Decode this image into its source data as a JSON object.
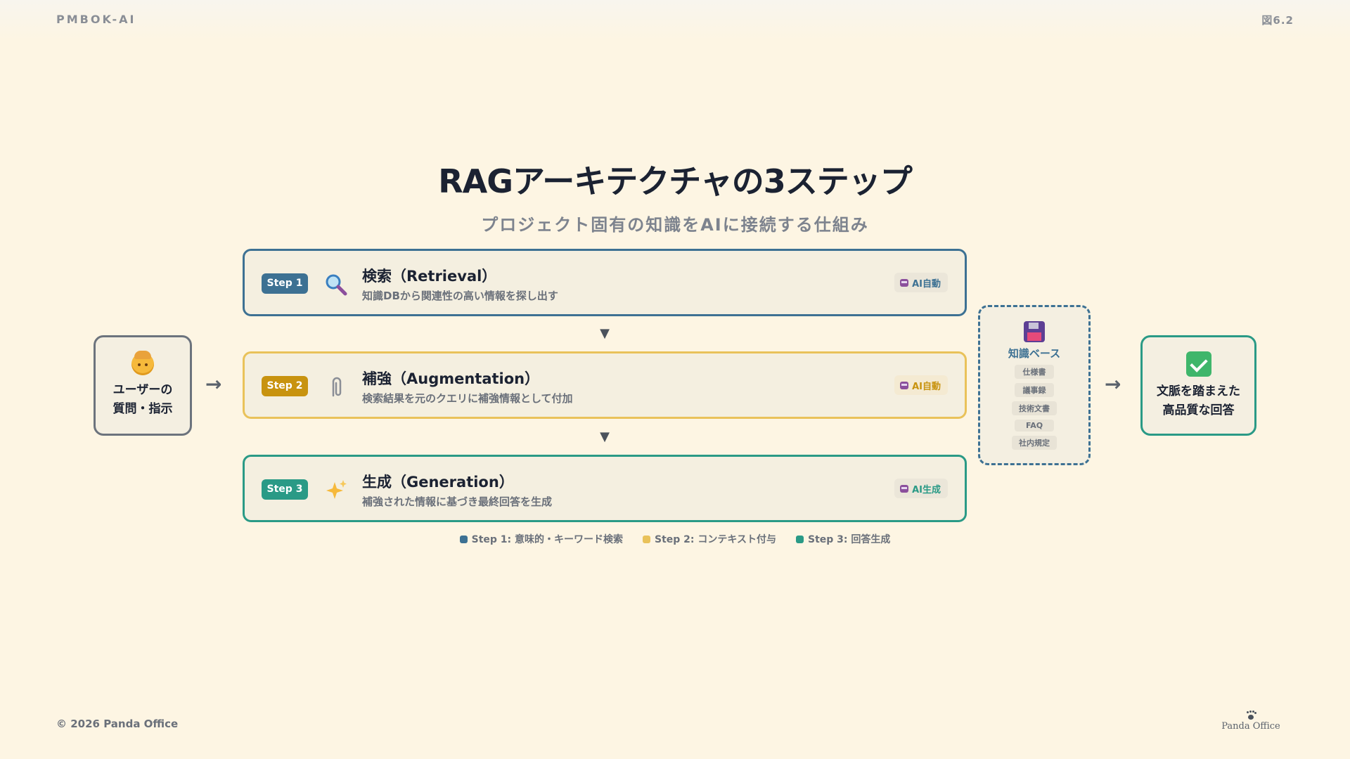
{
  "header": {
    "brand": "PMBOK-AI",
    "figure_no": "図6.2"
  },
  "title": "RAGアーキテクチャの3ステップ",
  "subtitle": "プロジェクト固有の知識をAIに接続する仕組み",
  "user": {
    "label_line1": "ユーザーの",
    "label_line2": "質問・指示",
    "icon": "person-icon"
  },
  "steps": [
    {
      "badge": "Step 1",
      "title": "検索（Retrieval）",
      "desc": "知識DBから関連性の高い情報を探し出す",
      "tag": "AI自動",
      "icon": "magnifier-icon",
      "color": "#3d7193"
    },
    {
      "badge": "Step 2",
      "title": "補強（Augmentation）",
      "desc": "検索結果を元のクエリに補強情報として付加",
      "tag": "AI自動",
      "icon": "paperclip-icon",
      "color": "#c8930f"
    },
    {
      "badge": "Step 3",
      "title": "生成（Generation）",
      "desc": "補強された情報に基づき最終回答を生成",
      "tag": "AI生成",
      "icon": "sparkles-icon",
      "color": "#2a9a86"
    }
  ],
  "knowledge_base": {
    "title": "知識ベース",
    "icon": "floppy-disk-icon",
    "items": [
      "仕様書",
      "議事録",
      "技術文書",
      "FAQ",
      "社内規定"
    ]
  },
  "result": {
    "label_line1": "文脈を踏まえた",
    "label_line2": "高品質な回答",
    "icon": "check-mark-icon"
  },
  "legend": [
    {
      "label": "Step 1: 意味的・キーワード検索",
      "color": "#3d7193"
    },
    {
      "label": "Step 2: コンテキスト付与",
      "color": "#e9c25a"
    },
    {
      "label": "Step 3: 回答生成",
      "color": "#2a9a86"
    }
  ],
  "footer": {
    "copyright": "© 2026 Panda Office",
    "logo_text": "Panda Office"
  },
  "colors": {
    "background": "#fdf5e3",
    "step1": "#3d7193",
    "step2": "#e9c25a",
    "step3": "#2a9a86"
  }
}
